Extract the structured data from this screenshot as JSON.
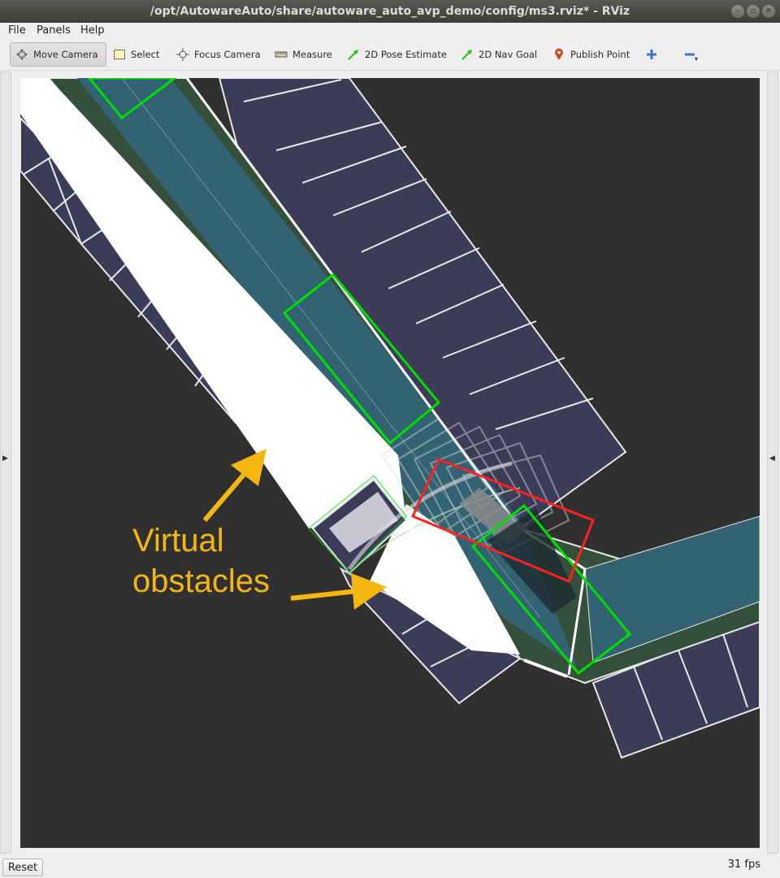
{
  "window": {
    "title": "/opt/AutowareAuto/share/autoware_auto_avp_demo/config/ms3.rviz* - RViz"
  },
  "menubar": {
    "items": [
      "File",
      "Panels",
      "Help"
    ]
  },
  "toolbar": {
    "tools": [
      {
        "label": "Move Camera",
        "icon": "move-camera-icon",
        "active": true
      },
      {
        "label": "Select",
        "icon": "select-icon"
      },
      {
        "label": "Focus Camera",
        "icon": "focus-camera-icon"
      },
      {
        "label": "Measure",
        "icon": "measure-icon"
      },
      {
        "label": "2D Pose Estimate",
        "icon": "pose-estimate-arrow-icon"
      },
      {
        "label": "2D Nav Goal",
        "icon": "nav-goal-arrow-icon"
      },
      {
        "label": "Publish Point",
        "icon": "location-pin-icon"
      }
    ],
    "add_icon": "plus-icon",
    "remove_icon": "minus-icon"
  },
  "viewport": {
    "annotation": {
      "line1": "Virtual",
      "line2": "obstacles",
      "color": "#f4b70f"
    },
    "colors": {
      "background": "#303030",
      "parking": "#3c3c58",
      "lane": "#336272",
      "border": "#34503a",
      "obstacle": "#ffffff",
      "footprint": "#00e000",
      "collision": "#ff2020"
    }
  },
  "statusbar": {
    "reset_label": "Reset",
    "fps": "31 fps"
  }
}
